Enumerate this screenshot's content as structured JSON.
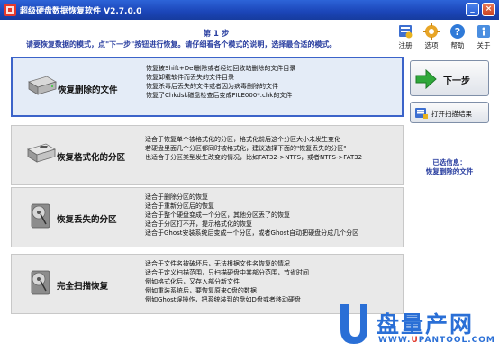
{
  "window": {
    "title": "超级硬盘数据恢复软件 V2.7.0.0",
    "minimize_glyph": "_",
    "close_glyph": "×"
  },
  "header": {
    "step": "第 1 步",
    "instruction": "请要恢复数据的模式，点\"下一步\"按钮进行恢复。请仔细看各个模式的说明，选择最合适的模式。"
  },
  "toolbar": [
    {
      "label": "注册",
      "icon": "register-icon"
    },
    {
      "label": "选项",
      "icon": "options-gear-icon"
    },
    {
      "label": "帮助",
      "icon": "help-icon"
    },
    {
      "label": "关于",
      "icon": "about-icon"
    }
  ],
  "modes": [
    {
      "name": "恢复删除的文件",
      "selected": true,
      "desc": [
        "恢复被Shift+Del删除或者经过回收站删除的文件目录",
        "恢复卸载软件而丢失的文件目录",
        "恢复杀毒后丢失的文件或者因为病毒删除的文件",
        "恢复了Chkdsk磁盘检查后变成FILE000*.chk的文件"
      ]
    },
    {
      "name": "恢复格式化的分区",
      "selected": false,
      "desc": [
        "适合于恢复单个被格式化的分区，格式化前后这个分区大小未发生变化",
        "若硬盘里面几个分区都同时被格式化，建议选择下面的\"恢复丢失的分区\"",
        "也适合于分区类型发生改变的情况，比如FAT32->NTFS，或者NTFS->FAT32"
      ]
    },
    {
      "name": "恢复丢失的分区",
      "selected": false,
      "desc": [
        "适合于删除分区的恢复",
        "适合于重新分区后的恢复",
        "适合于整个硬盘变成一个分区，其他分区丢了的恢复",
        "适合于分区打不开，提示格式化的恢复",
        "适合于Ghost安装系统后变成一个分区，或者Ghost自动把硬盘分成几个分区"
      ]
    },
    {
      "name": "完全扫描恢复",
      "selected": false,
      "desc": [
        "适合于文件名被破坏后，无法根据文件名恢复的情况",
        "适合于定义扫描范围，只扫描硬盘中某部分范围，节省时间",
        "例如格式化后，又存入部分新文件",
        "例如重装系统后，要恢复原来C盘的数据",
        "例如Ghost误操作，把系统装到的盘如D盘或者移动硬盘"
      ]
    }
  ],
  "actions": {
    "next_label": "下一步",
    "open_scan_label": "打开扫描结果"
  },
  "selected_info": {
    "label": "已选信息：",
    "value": "恢复删除的文件"
  },
  "watermark": {
    "brand": "盘量产网",
    "url_prefix": "WWW.",
    "url_highlight": "U",
    "url_suffix": "PANTOOL.COM"
  },
  "colors": {
    "titlebar": "#1b45b8",
    "accent_text": "#2a3fa0",
    "selected_border": "#3b63c9",
    "next_arrow": "#2fa83a",
    "watermark": "#2a6fd6"
  }
}
